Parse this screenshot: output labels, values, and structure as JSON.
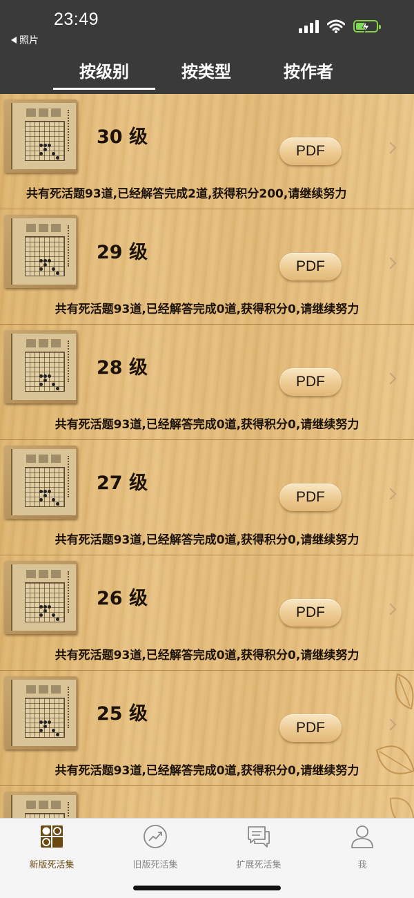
{
  "status_bar": {
    "time": "23:49",
    "back_app": "照片"
  },
  "tabs": [
    {
      "label": "按级别",
      "active": true
    },
    {
      "label": "按类型",
      "active": false
    },
    {
      "label": "按作者",
      "active": false
    }
  ],
  "list": [
    {
      "level": "30 级",
      "button": "PDF",
      "description": "共有死活题93道,已经解答完成2道,获得积分200,请继续努力"
    },
    {
      "level": "29 级",
      "button": "PDF",
      "description": "共有死活题93道,已经解答完成0道,获得积分0,请继续努力"
    },
    {
      "level": "28 级",
      "button": "PDF",
      "description": "共有死活题93道,已经解答完成0道,获得积分0,请继续努力"
    },
    {
      "level": "27 级",
      "button": "PDF",
      "description": "共有死活题93道,已经解答完成0道,获得积分0,请继续努力"
    },
    {
      "level": "26 级",
      "button": "PDF",
      "description": "共有死活题93道,已经解答完成0道,获得积分0,请继续努力"
    },
    {
      "level": "25 级",
      "button": "PDF",
      "description": "共有死活题93道,已经解答完成0道,获得积分0,请继续努力"
    }
  ],
  "tabbar": [
    {
      "label": "新版死活集",
      "icon": "go-board-icon",
      "active": true
    },
    {
      "label": "旧版死活集",
      "icon": "trend-chart-icon",
      "active": false
    },
    {
      "label": "扩展死活集",
      "icon": "chat-bubbles-icon",
      "active": false
    },
    {
      "label": "我",
      "icon": "person-icon",
      "active": false
    }
  ],
  "colors": {
    "header_bg": "#3a3a3a",
    "wood": "#e5bd7d",
    "active_tab_icon": "#6b4a12",
    "battery": "#7ed957"
  }
}
